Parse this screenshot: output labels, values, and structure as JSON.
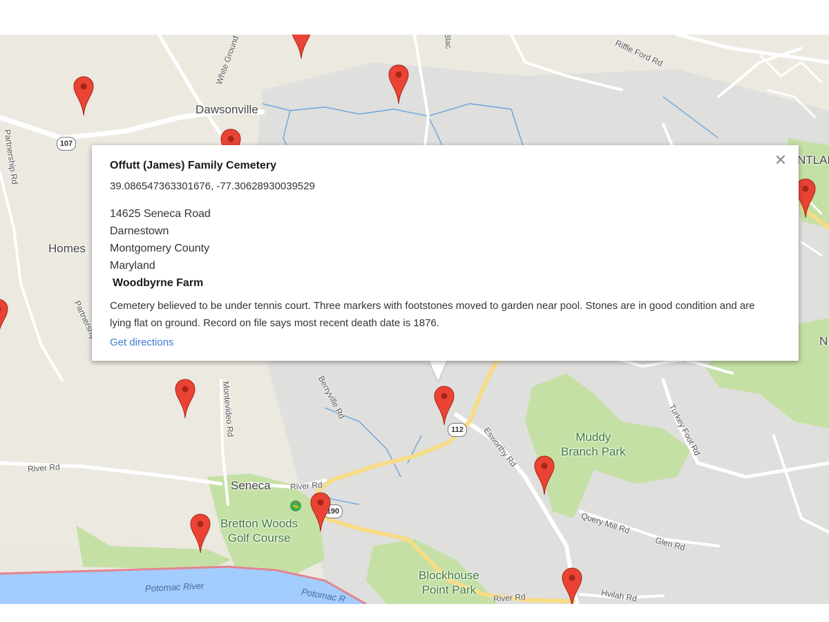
{
  "info_window": {
    "title": "Offutt (James) Family Cemetery",
    "coordinates": "39.086547363301676, -77.30628930039529",
    "address_lines": [
      "14625 Seneca Road",
      "Darnestown",
      "Montgomery County",
      "Maryland"
    ],
    "property_name": "Woodbyrne Farm",
    "description": "Cemetery believed to be under tennis court. Three markers with footstones moved to garden near pool. Stones are in good condition and are lying flat on ground. Record on file says most recent death date is 1876.",
    "directions_link": "Get directions",
    "close_icon": "close-icon"
  },
  "map_labels": {
    "towns": [
      "Dawsonville",
      "Homes",
      "Seneca",
      "NTLAN",
      "N"
    ],
    "parks": [
      {
        "lines": [
          "Muddy",
          "Branch Park"
        ]
      },
      {
        "lines": [
          "Bretton Woods",
          "Golf Course"
        ]
      },
      {
        "lines": [
          "Blockhouse",
          "Point Park"
        ]
      }
    ],
    "water": [
      "Potomac River",
      "Potomac R"
    ],
    "roads": [
      "White Ground",
      "Riffle Ford Rd",
      "Partnership Rd",
      "Partnership Rd",
      "Berryville Rd",
      "Montevideo Rd",
      "River Rd",
      "River Rd",
      "River Rd",
      "Esworthy Rd",
      "Turkey Foot Rd",
      "Query Mill Rd",
      "Glen Rd",
      "Hvilah Rd",
      "Blac"
    ],
    "route_shields": [
      "107",
      "112",
      "190"
    ]
  },
  "colors": {
    "marker": "#ea4335",
    "marker_dark": "#a52714",
    "park_green": "#c5e0a5",
    "water_blue": "#a3ccff",
    "road_yellow": "#f7dc86",
    "land_light": "#ebe8df",
    "land_gray": "#dfdfdf",
    "stream_blue": "#6aa3dc",
    "link_blue": "#3a7bd5"
  }
}
